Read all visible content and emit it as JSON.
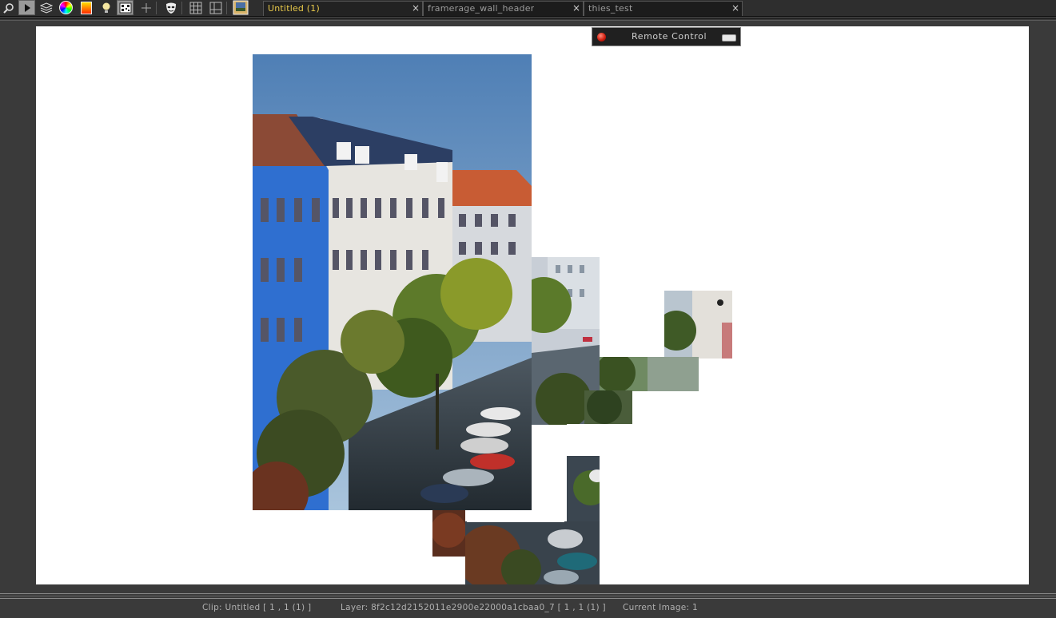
{
  "toolbar": {
    "buttons": [
      {
        "id": "zoom",
        "icon": "magnifier-icon"
      },
      {
        "id": "select",
        "icon": "pointer-arrow-icon"
      },
      {
        "id": "layers",
        "icon": "layers-stack-icon"
      },
      {
        "id": "color",
        "icon": "color-wheel-icon"
      },
      {
        "id": "gradient",
        "icon": "gradient-swatch-icon"
      },
      {
        "id": "light",
        "icon": "lightbulb-icon"
      },
      {
        "id": "qr",
        "icon": "qr-code-icon"
      },
      {
        "id": "move",
        "icon": "move-arrows-icon"
      },
      {
        "id": "mask",
        "icon": "mask-face-icon"
      },
      {
        "id": "grid",
        "icon": "grid-icon"
      },
      {
        "id": "frame",
        "icon": "frame-icon"
      },
      {
        "id": "image",
        "icon": "framed-picture-icon"
      }
    ]
  },
  "tabs": [
    {
      "label": "Untitled (1)",
      "active": true,
      "close": "×"
    },
    {
      "label": "framerage_wall_header",
      "active": false,
      "close": "×"
    },
    {
      "label": "thies_test",
      "active": false,
      "close": "×"
    }
  ],
  "remote_control": {
    "label": "Remote Control",
    "status_color": "#d02010"
  },
  "statusbar": {
    "clip": "Clip: Untitled [ 1 , 1  (1) ]",
    "layer": "Layer: 8f2c12d2152011e2900e22000a1cbaa0_7 [ 1 , 1  (1) ]",
    "current_image": "Current Image: 1"
  },
  "colors": {
    "background": "#3a3a3a",
    "canvas": "#ffffff",
    "active_tab_text": "#e8c94a",
    "inactive_tab_text": "#9a9a9a"
  }
}
